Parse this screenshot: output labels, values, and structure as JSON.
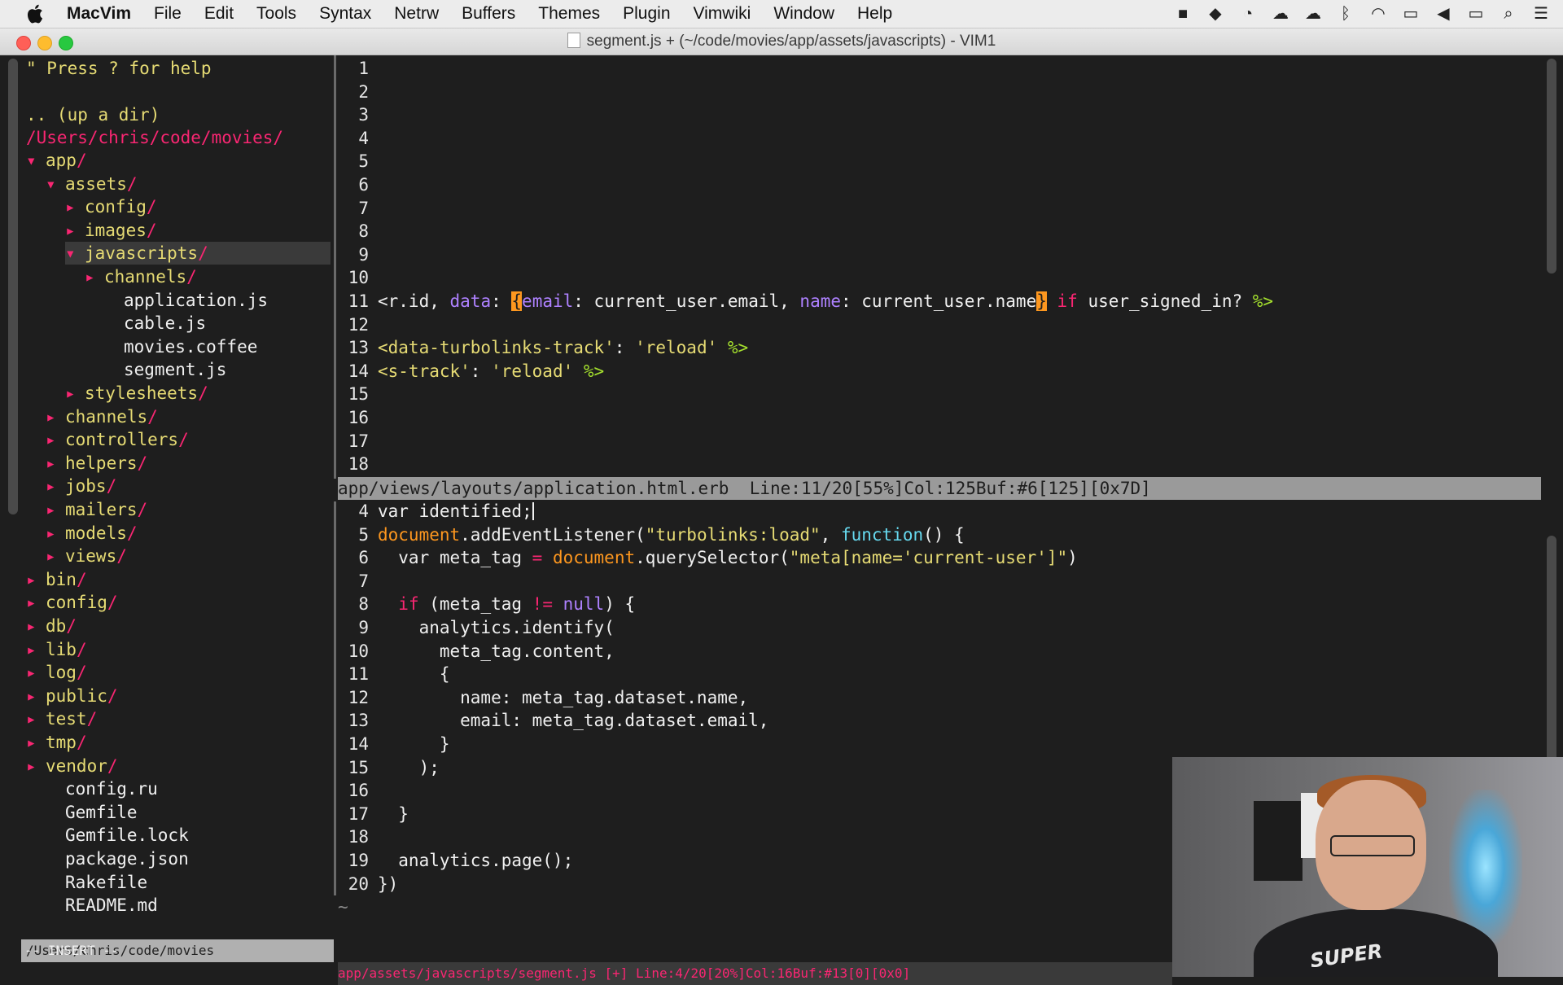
{
  "menubar": {
    "app_name": "MacVim",
    "items": [
      "File",
      "Edit",
      "Tools",
      "Syntax",
      "Netrw",
      "Buffers",
      "Themes",
      "Plugin",
      "Vimwiki",
      "Window",
      "Help"
    ],
    "status_icons": [
      "camera-icon",
      "dropbox-icon",
      "activity-icon",
      "cloud-icon",
      "cloud-dark-icon",
      "bluetooth-icon",
      "wifi-icon",
      "airplay-icon",
      "volume-icon",
      "battery-icon",
      "spotlight-search-icon",
      "notification-center-icon"
    ]
  },
  "window": {
    "title": "segment.js + (~/code/movies/app/assets/javascripts) - VIM1"
  },
  "tree": {
    "help": "\" Press ? for help",
    "up_dir": ".. (up a dir)",
    "root": "/Users/chris/code/movies/",
    "entries": [
      {
        "indent": 0,
        "arrow": "down",
        "name": "app",
        "dir": true
      },
      {
        "indent": 1,
        "arrow": "down",
        "name": "assets",
        "dir": true
      },
      {
        "indent": 2,
        "arrow": "right",
        "name": "config",
        "dir": true
      },
      {
        "indent": 2,
        "arrow": "right",
        "name": "images",
        "dir": true
      },
      {
        "indent": 2,
        "arrow": "down",
        "name": "javascripts",
        "dir": true,
        "selected": true
      },
      {
        "indent": 3,
        "arrow": "right",
        "name": "channels",
        "dir": true
      },
      {
        "indent": 4,
        "arrow": "",
        "name": "application.js",
        "dir": false
      },
      {
        "indent": 4,
        "arrow": "",
        "name": "cable.js",
        "dir": false
      },
      {
        "indent": 4,
        "arrow": "",
        "name": "movies.coffee",
        "dir": false
      },
      {
        "indent": 4,
        "arrow": "",
        "name": "segment.js",
        "dir": false
      },
      {
        "indent": 2,
        "arrow": "right",
        "name": "stylesheets",
        "dir": true
      },
      {
        "indent": 1,
        "arrow": "right",
        "name": "channels",
        "dir": true
      },
      {
        "indent": 1,
        "arrow": "right",
        "name": "controllers",
        "dir": true
      },
      {
        "indent": 1,
        "arrow": "right",
        "name": "helpers",
        "dir": true
      },
      {
        "indent": 1,
        "arrow": "right",
        "name": "jobs",
        "dir": true
      },
      {
        "indent": 1,
        "arrow": "right",
        "name": "mailers",
        "dir": true
      },
      {
        "indent": 1,
        "arrow": "right",
        "name": "models",
        "dir": true
      },
      {
        "indent": 1,
        "arrow": "right",
        "name": "views",
        "dir": true
      },
      {
        "indent": 0,
        "arrow": "right",
        "name": "bin",
        "dir": true
      },
      {
        "indent": 0,
        "arrow": "right",
        "name": "config",
        "dir": true
      },
      {
        "indent": 0,
        "arrow": "right",
        "name": "db",
        "dir": true
      },
      {
        "indent": 0,
        "arrow": "right",
        "name": "lib",
        "dir": true
      },
      {
        "indent": 0,
        "arrow": "right",
        "name": "log",
        "dir": true
      },
      {
        "indent": 0,
        "arrow": "right",
        "name": "public",
        "dir": true
      },
      {
        "indent": 0,
        "arrow": "right",
        "name": "test",
        "dir": true
      },
      {
        "indent": 0,
        "arrow": "right",
        "name": "tmp",
        "dir": true
      },
      {
        "indent": 0,
        "arrow": "right",
        "name": "vendor",
        "dir": true
      },
      {
        "indent": 1,
        "arrow": "",
        "name": "config.ru",
        "dir": false
      },
      {
        "indent": 1,
        "arrow": "",
        "name": "Gemfile",
        "dir": false
      },
      {
        "indent": 1,
        "arrow": "",
        "name": "Gemfile.lock",
        "dir": false
      },
      {
        "indent": 1,
        "arrow": "",
        "name": "package.json",
        "dir": false
      },
      {
        "indent": 1,
        "arrow": "",
        "name": "Rakefile",
        "dir": false
      },
      {
        "indent": 1,
        "arrow": "",
        "name": "README.md",
        "dir": false
      }
    ],
    "cwd_status": "/Users/chris/code/movies"
  },
  "top_pane": {
    "lines": [
      {
        "n": "1",
        "segs": []
      },
      {
        "n": "2",
        "segs": []
      },
      {
        "n": "3",
        "segs": []
      },
      {
        "n": "4",
        "segs": []
      },
      {
        "n": "5",
        "segs": []
      },
      {
        "n": "6",
        "segs": []
      },
      {
        "n": "7",
        "segs": []
      },
      {
        "n": "8",
        "segs": []
      },
      {
        "n": "9",
        "segs": []
      },
      {
        "n": "10",
        "segs": []
      },
      {
        "n": "11",
        "segs": [
          {
            "t": "<r.id, ",
            "c": "white"
          },
          {
            "t": "data",
            "c": "purple"
          },
          {
            "t": ": ",
            "c": "white"
          },
          {
            "t": "{",
            "c": "cursor"
          },
          {
            "t": "email",
            "c": "purple"
          },
          {
            "t": ": current_user.email, ",
            "c": "white"
          },
          {
            "t": "name",
            "c": "purple"
          },
          {
            "t": ": current_user.name",
            "c": "white"
          },
          {
            "t": "}",
            "c": "cursor"
          },
          {
            "t": " ",
            "c": "white"
          },
          {
            "t": "if",
            "c": "red"
          },
          {
            "t": " user_signed_in? ",
            "c": "white"
          },
          {
            "t": "%>",
            "c": "green"
          }
        ]
      },
      {
        "n": "12",
        "segs": []
      },
      {
        "n": "13",
        "segs": [
          {
            "t": "<data-turbolinks-track'",
            "c": "yellow"
          },
          {
            "t": ": ",
            "c": "white"
          },
          {
            "t": "'reload'",
            "c": "yellow"
          },
          {
            "t": " %>",
            "c": "green"
          }
        ]
      },
      {
        "n": "14",
        "segs": [
          {
            "t": "<s-track'",
            "c": "yellow"
          },
          {
            "t": ": ",
            "c": "white"
          },
          {
            "t": "'reload'",
            "c": "yellow"
          },
          {
            "t": " %>",
            "c": "green"
          }
        ]
      },
      {
        "n": "15",
        "segs": []
      },
      {
        "n": "16",
        "segs": []
      },
      {
        "n": "17",
        "segs": []
      },
      {
        "n": "18",
        "segs": []
      }
    ],
    "status": "app/views/layouts/application.html.erb  Line:11/20[55%]Col:125Buf:#6[125][0x7D]"
  },
  "bottom_pane": {
    "lines": [
      {
        "n": "4",
        "segs": [
          {
            "t": "var identified;",
            "c": "white"
          }
        ],
        "caret": true
      },
      {
        "n": "5",
        "segs": [
          {
            "t": "document",
            "c": "orange"
          },
          {
            "t": ".addEventListener(",
            "c": "white"
          },
          {
            "t": "\"turbolinks:load\"",
            "c": "yellow"
          },
          {
            "t": ", ",
            "c": "white"
          },
          {
            "t": "function",
            "c": "blue"
          },
          {
            "t": "() {",
            "c": "white"
          }
        ]
      },
      {
        "n": "6",
        "segs": [
          {
            "t": "  var meta_tag ",
            "c": "white"
          },
          {
            "t": "=",
            "c": "red"
          },
          {
            "t": " ",
            "c": "white"
          },
          {
            "t": "document",
            "c": "orange"
          },
          {
            "t": ".querySelector(",
            "c": "white"
          },
          {
            "t": "\"meta[name='current-user']\"",
            "c": "yellow"
          },
          {
            "t": ")",
            "c": "white"
          }
        ]
      },
      {
        "n": "7",
        "segs": []
      },
      {
        "n": "8",
        "segs": [
          {
            "t": "  ",
            "c": "white"
          },
          {
            "t": "if",
            "c": "red"
          },
          {
            "t": " (meta_tag ",
            "c": "white"
          },
          {
            "t": "!=",
            "c": "red"
          },
          {
            "t": " ",
            "c": "white"
          },
          {
            "t": "null",
            "c": "purple"
          },
          {
            "t": ") {",
            "c": "white"
          }
        ]
      },
      {
        "n": "9",
        "segs": [
          {
            "t": "    analytics.identify(",
            "c": "white"
          }
        ]
      },
      {
        "n": "10",
        "segs": [
          {
            "t": "      meta_tag.content,",
            "c": "white"
          }
        ]
      },
      {
        "n": "11",
        "segs": [
          {
            "t": "      {",
            "c": "white"
          }
        ]
      },
      {
        "n": "12",
        "segs": [
          {
            "t": "        name: meta_tag.dataset.name,",
            "c": "white"
          }
        ]
      },
      {
        "n": "13",
        "segs": [
          {
            "t": "        email: meta_tag.dataset.email,",
            "c": "white"
          }
        ]
      },
      {
        "n": "14",
        "segs": [
          {
            "t": "      }",
            "c": "white"
          }
        ]
      },
      {
        "n": "15",
        "segs": [
          {
            "t": "    );",
            "c": "white"
          }
        ]
      },
      {
        "n": "16",
        "segs": []
      },
      {
        "n": "17",
        "segs": [
          {
            "t": "  }",
            "c": "white"
          }
        ]
      },
      {
        "n": "18",
        "segs": []
      },
      {
        "n": "19",
        "segs": [
          {
            "t": "  analytics.page();",
            "c": "white"
          }
        ]
      },
      {
        "n": "20",
        "segs": [
          {
            "t": "})",
            "c": "white"
          }
        ]
      }
    ],
    "tilde": "~",
    "status": "app/assets/javascripts/segment.js [+] Line:4/20[20%]Col:16Buf:#13[0][0x0]"
  },
  "mode": "-- INSERT --",
  "webcam": {
    "shirt_text": "SUPER"
  }
}
